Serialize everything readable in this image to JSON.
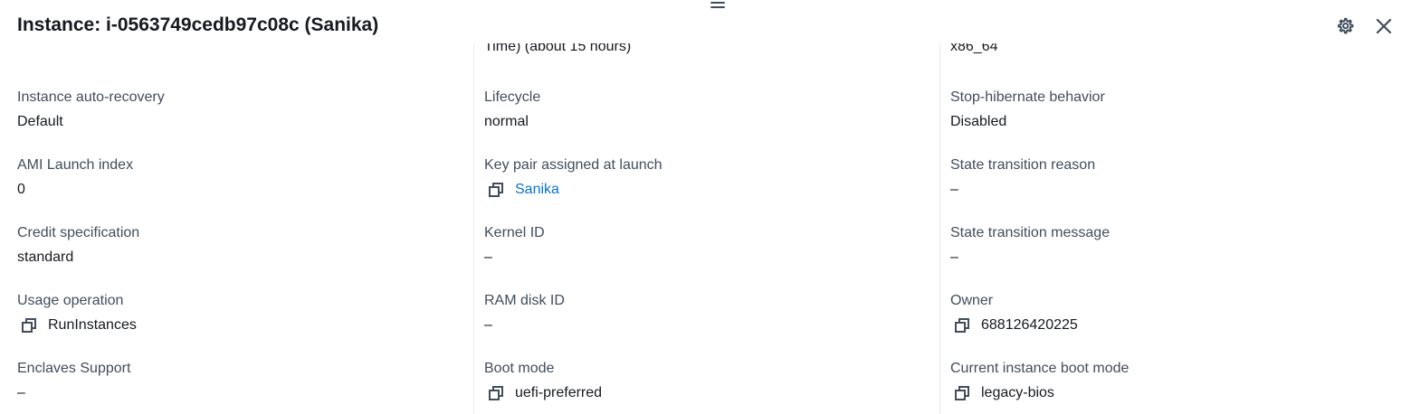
{
  "header": {
    "title": "Instance: i-0563749cedb97c08c (Sanika)"
  },
  "partial_row": {
    "col2_value": "Time) (about 15 hours)",
    "col3_value": "x86_64"
  },
  "columns": [
    [
      {
        "label": "Instance auto-recovery",
        "value": "Default"
      },
      {
        "label": "AMI Launch index",
        "value": "0"
      },
      {
        "label": "Credit specification",
        "value": "standard"
      },
      {
        "label": "Usage operation",
        "value": "RunInstances",
        "copyable": true
      },
      {
        "label": "Enclaves Support",
        "value": "–"
      }
    ],
    [
      {
        "label": "Lifecycle",
        "value": "normal"
      },
      {
        "label": "Key pair assigned at launch",
        "value": "Sanika",
        "copyable": true,
        "link": true
      },
      {
        "label": "Kernel ID",
        "value": "–"
      },
      {
        "label": "RAM disk ID",
        "value": "–"
      },
      {
        "label": "Boot mode",
        "value": "uefi-preferred",
        "copyable": true
      }
    ],
    [
      {
        "label": "Stop-hibernate behavior",
        "value": "Disabled"
      },
      {
        "label": "State transition reason",
        "value": "–"
      },
      {
        "label": "State transition message",
        "value": "–"
      },
      {
        "label": "Owner",
        "value": "688126420225",
        "copyable": true
      },
      {
        "label": "Current instance boot mode",
        "value": "legacy-bios",
        "copyable": true
      }
    ]
  ],
  "icons": {
    "settings": "gear-icon",
    "close": "close-icon",
    "copy": "copy-icon",
    "drag": "drag-handle-icon"
  },
  "colors": {
    "label": "#414d5c",
    "value": "#16191f",
    "link": "#0972d3",
    "divider": "#e9ebed"
  }
}
